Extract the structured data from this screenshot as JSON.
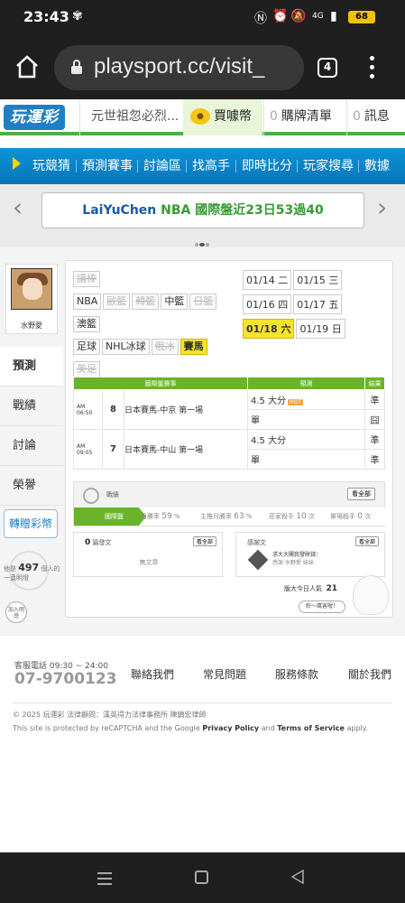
{
  "status": {
    "time": "23:43",
    "battery": "68",
    "network": "4G"
  },
  "browser": {
    "url": "playsport.cc/visit_",
    "tab_count": "4"
  },
  "header": {
    "logo": "玩運彩",
    "marquee": "元世祖忽必烈...",
    "buy_coin": "買噱幣",
    "cart_count": "0",
    "cart_label": "購牌清單",
    "msg_count": "0",
    "msg_label": "訊息"
  },
  "nav": [
    "玩競猜",
    "預測賽事",
    "討論區",
    "找高手",
    "即時比分",
    "玩家搜尋",
    "數據"
  ],
  "banner": {
    "user": "LaiYuChen",
    "league": "NBA",
    "text": "國際盤近23日53過40"
  },
  "profile": {
    "nickname": "水野愛"
  },
  "side_menu": [
    "預測",
    "戰績",
    "討論",
    "榮譽"
  ],
  "gift_button": "轉贈彩幣",
  "lamp": {
    "prefix": "他是",
    "count": "497",
    "suffix": "個人的一盞明燈",
    "join": "加入明燈"
  },
  "filters": [
    {
      "label": "讓棒",
      "state": "disabled"
    },
    {
      "label": "NBA",
      "state": "normal"
    },
    {
      "label": "歐籃",
      "state": "disabled"
    },
    {
      "label": "韓籃",
      "state": "disabled"
    },
    {
      "label": "中籃",
      "state": "normal"
    },
    {
      "label": "日籃",
      "state": "disabled"
    },
    {
      "label": "澳籃",
      "state": "normal"
    },
    {
      "label": "足球",
      "state": "normal"
    },
    {
      "label": "NHL冰球",
      "state": "normal"
    },
    {
      "label": "俄冰",
      "state": "disabled"
    },
    {
      "label": "賽馬",
      "state": "selected"
    },
    {
      "label": "美足",
      "state": "disabled"
    }
  ],
  "dates": [
    {
      "date": "01/14",
      "day": "二",
      "selected": false
    },
    {
      "date": "01/15",
      "day": "三",
      "selected": false
    },
    {
      "date": "01/16",
      "day": "四",
      "selected": false
    },
    {
      "date": "01/17",
      "day": "五",
      "selected": false
    },
    {
      "date": "01/18",
      "day": "六",
      "selected": true
    },
    {
      "date": "01/19",
      "day": "日",
      "selected": false
    }
  ],
  "table": {
    "headers": [
      "國際盤賽事",
      "預測",
      "結果"
    ],
    "rows": [
      {
        "time": "AM 06:50",
        "num": "8",
        "game": "日本賽馬-中京 第一場",
        "picks": [
          {
            "pick": "4.5 大分",
            "hot": "HOT",
            "result": "準",
            "win": true
          },
          {
            "pick": "單",
            "hot": "",
            "result": "囧",
            "win": false
          }
        ]
      },
      {
        "time": "AM 09:05",
        "num": "7",
        "game": "日本賽馬-中山 第一場",
        "picks": [
          {
            "pick": "4.5 大分",
            "hot": "",
            "result": "準",
            "win": true
          },
          {
            "pick": "單",
            "hot": "",
            "result": "準",
            "win": true
          }
        ]
      }
    ]
  },
  "stats": {
    "title": "戰績",
    "all_button": "看全部",
    "label": "國際盤",
    "month_rate_label": "月勝率",
    "month_rate": "59",
    "pct": "%",
    "main_rate_label": "主推月勝率",
    "main_rate": "63",
    "streak_label": "莊家殺手",
    "streak": "10",
    "times": "次",
    "single_label": "單場殺手",
    "single": "0"
  },
  "posts": {
    "count": "0",
    "label": "篇發文",
    "button": "看全部",
    "empty": "無文章"
  },
  "thanks": {
    "label": "感謝文",
    "button": "看全部",
    "text": "求大大賜我發財錢：",
    "sub": "感謝 水野愛 妹妹"
  },
  "popularity": {
    "label": "版大今日人氣",
    "value": "21",
    "fan": "粉～厲害喔！"
  },
  "footer": {
    "phone_label": "客服電話 09:30 ~ 24:00",
    "phone": "07-9700123",
    "links": [
      "聯絡我們",
      "常見問題",
      "服務條款",
      "關於我們"
    ],
    "copyright": "© 2025 玩運彩 法律顧問：漢英得力法律事務所 陳鎮宏律師",
    "recaptcha_prefix": "This site is protected by reCAPTCHA and the Google",
    "privacy": "Privacy Policy",
    "and": "and",
    "terms": "Terms of Service",
    "apply": "apply."
  }
}
